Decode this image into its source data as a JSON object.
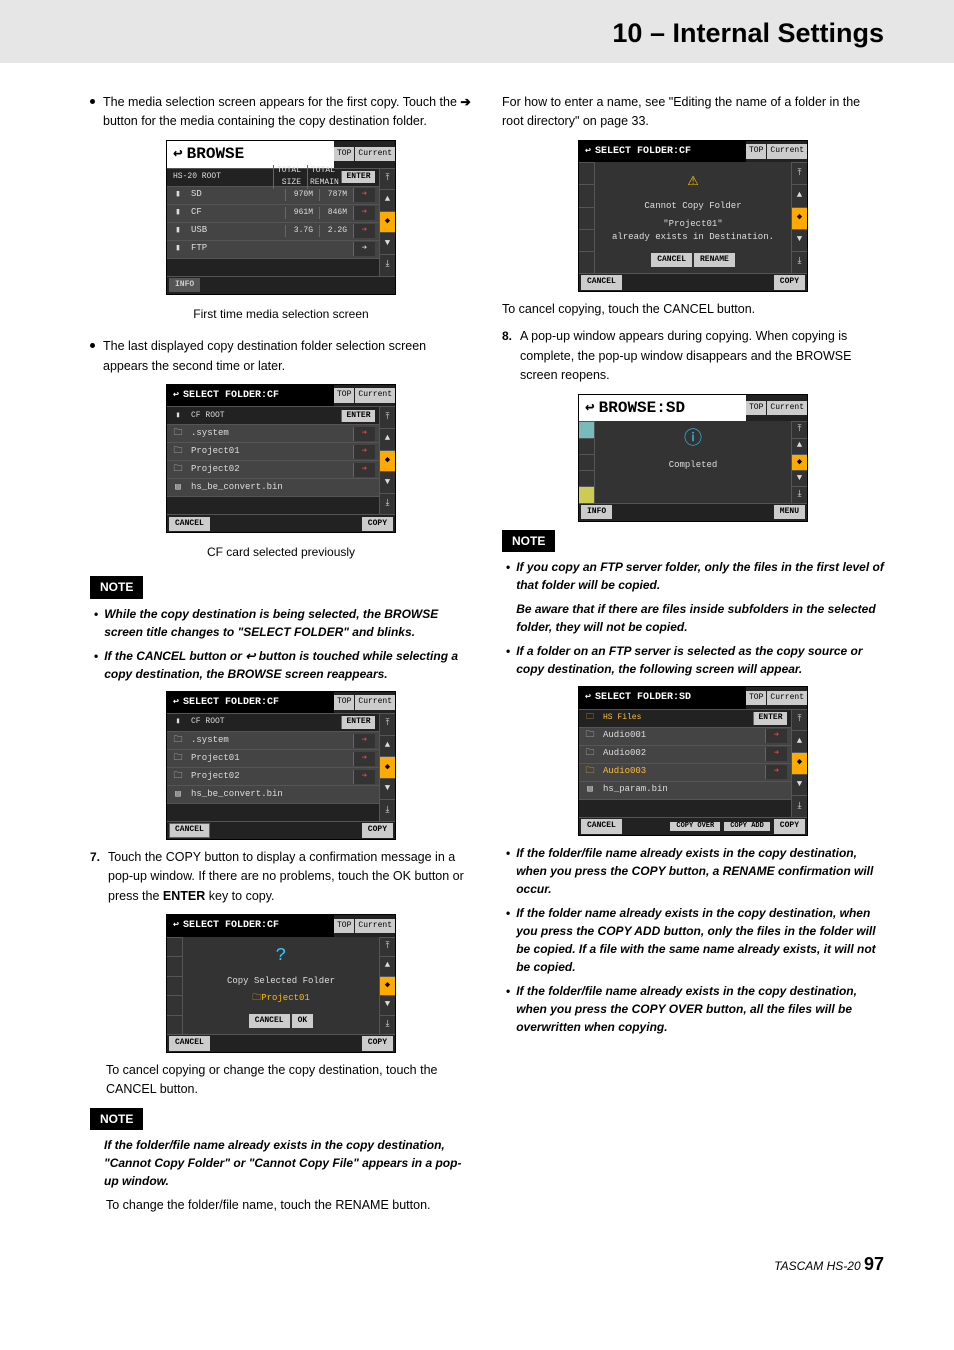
{
  "header": {
    "title": "10 – Internal Settings"
  },
  "left": {
    "b1": "The media selection screen appears for the first copy. Touch the",
    "b1_arrow": " ➔ ",
    "b1_after": "button for the media containing the copy destination folder.",
    "cap1": "First time media selection screen",
    "b2": "The last displayed copy destination folder selection screen appears the second time or later.",
    "cap2": "CF card selected previously",
    "note1_label": "NOTE",
    "note1_i1": "While the copy destination is being selected, the BROWSE screen title changes to \"SELECT FOLDER\" and blinks.",
    "note1_i2_pre": "If the CANCEL button or ",
    "note1_i2_mid": " button is touched while selecting a copy destination, the BROWSE screen reappears.",
    "step7_num": "7.",
    "step7_a": "Touch the COPY button to display a confirmation message in a pop-up window. If there are no problems, touch the OK button or press the ",
    "step7_enter": "ENTER",
    "step7_b": " key to copy.",
    "step7_cancel": "To cancel copying or change the copy destination, touch the CANCEL button.",
    "note2_label": "NOTE",
    "note2_text": "If the folder/file name already exists in the copy destination, \"Cannot Copy Folder\" or \"Cannot Copy File\" appears in a pop-up window.",
    "note2_after": "To change the folder/file name, touch the RENAME button."
  },
  "right": {
    "p1": "For how to enter a name, see \"Editing the name of a folder in the root directory\" on page 33.",
    "p2": "To cancel copying, touch the CANCEL button.",
    "step8_num": "8.",
    "step8_text": "A pop-up window appears during copying. When copying is complete, the pop-up window disappears and the BROWSE screen reopens.",
    "note3_label": "NOTE",
    "note3_i1a": "If you copy an FTP server folder, only the files in the first level of that folder will be copied.",
    "note3_i1b": "Be aware that if there are files inside subfolders in the selected folder, they will not be copied.",
    "note3_i2": "If a folder on an FTP server is selected as the copy source or copy destination, the following screen will appear.",
    "note3_i3": "If the folder/file name already exists in the copy destination, when you press the COPY button, a RENAME confirmation will occur.",
    "note3_i4": "If the folder name already exists in the copy destination, when you press the COPY ADD button, only the files in the folder will be copied. If a file with the same name already exists, it will not be copied.",
    "note3_i5": "If the folder/file name already exists in the copy destination, when you press the COPY OVER button, all the files will be overwritten when copying."
  },
  "footer": {
    "brand": "TASCAM HS-20 ",
    "page": "97"
  },
  "shots": {
    "browse": {
      "title": "BROWSE",
      "top": "TOP",
      "cur": "Current",
      "root": "HS-20 ROOT",
      "cols": {
        "size": "TOTAL SIZE",
        "remain": "TOTAL REMAIN"
      },
      "rows": [
        {
          "name": "SD",
          "size": "970M",
          "remain": "787M"
        },
        {
          "name": "CF",
          "size": "961M",
          "remain": "846M"
        },
        {
          "name": "USB",
          "size": "3.7G",
          "remain": "2.2G"
        },
        {
          "name": "FTP",
          "size": "",
          "remain": ""
        }
      ],
      "enter": "ENTER",
      "info": "INFO"
    },
    "selectcf": {
      "title": "SELECT FOLDER:CF",
      "top": "TOP",
      "cur": "Current",
      "root": "CF ROOT",
      "rows": [
        ".system",
        "Project01",
        "Project02",
        "hs_be_convert.bin"
      ],
      "enter": "ENTER",
      "cancel": "CANCEL",
      "copy": "COPY"
    },
    "selectcf2_cancel_highlight": true,
    "popup_copy": {
      "title": "SELECT FOLDER:CF",
      "text": "Copy Selected Folder",
      "proj": "Project01",
      "btn_cancel": "CANCEL",
      "btn_ok": "OK",
      "foot_cancel": "CANCEL",
      "foot_copy": "COPY"
    },
    "popup_cannot": {
      "title": "SELECT FOLDER:CF",
      "text1": "Cannot Copy Folder",
      "text2": "\"Project01\"",
      "text3": "already exists in Destination.",
      "btn_cancel": "CANCEL",
      "btn_rename": "RENAME",
      "foot_cancel": "CANCEL",
      "foot_copy": "COPY"
    },
    "browse_sd": {
      "title": "BROWSE:SD",
      "top": "TOP",
      "cur": "Current",
      "text": "Completed",
      "info": "INFO",
      "menu": "MENU"
    },
    "select_sd": {
      "title": "SELECT FOLDER:SD",
      "top": "TOP",
      "cur": "Current",
      "root": "HS Files",
      "rows": [
        "Audio001",
        "Audio002",
        "Audio003",
        "hs_param.bin"
      ],
      "selected_index": 2,
      "enter": "ENTER",
      "cancel": "CANCEL",
      "btn_over": "COPY OVER",
      "btn_add": "COPY ADD",
      "btn_copy": "COPY"
    }
  }
}
